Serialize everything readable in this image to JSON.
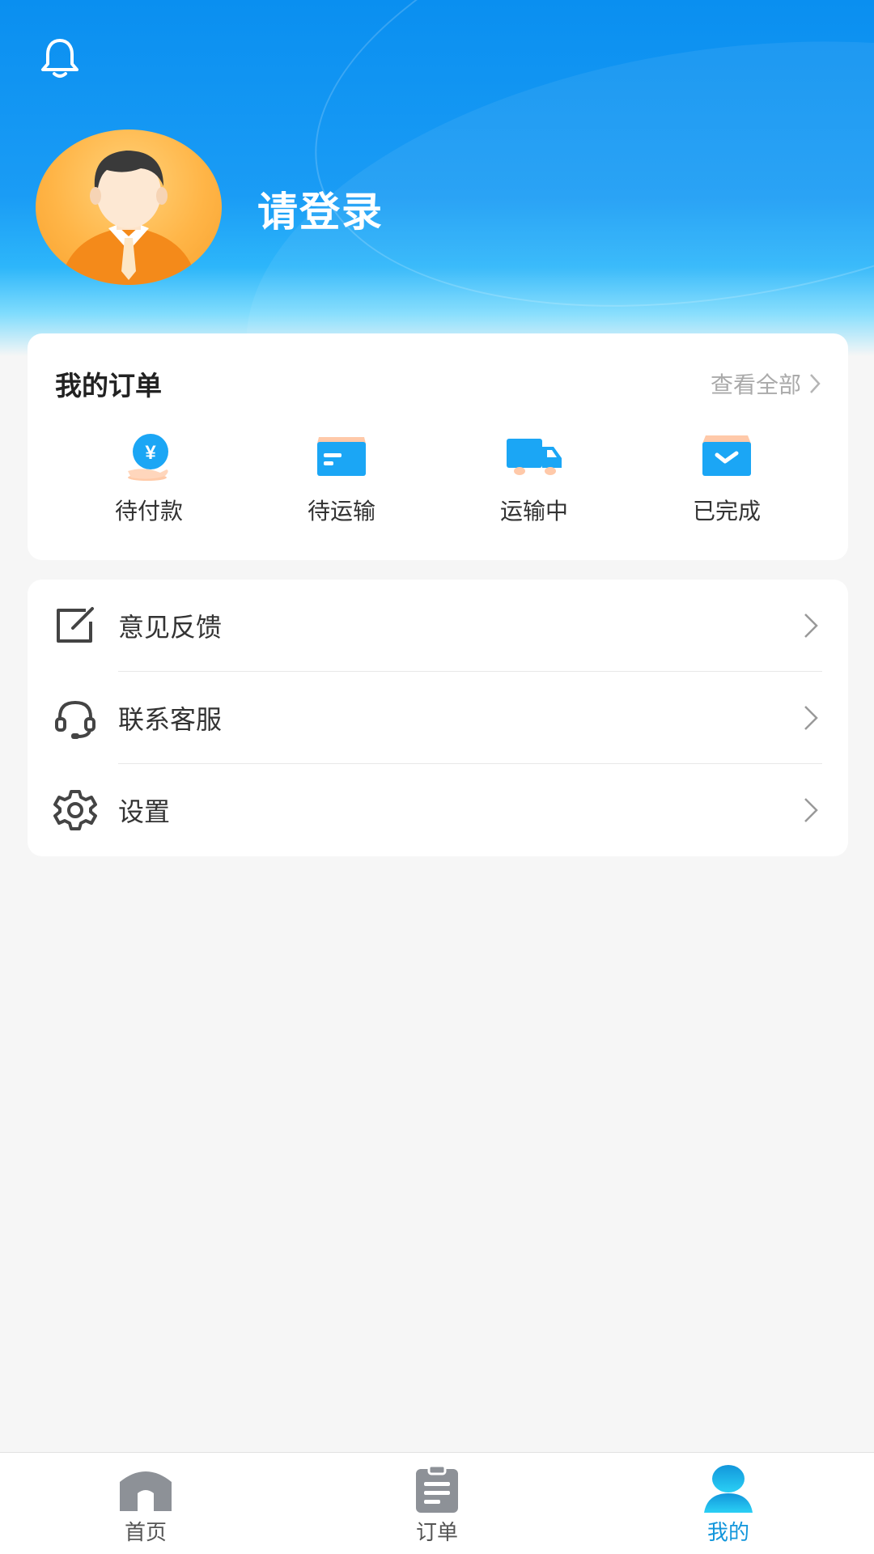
{
  "header": {
    "login_text": "请登录",
    "notification_icon": "bell-icon",
    "avatar_icon": "user-avatar"
  },
  "orders": {
    "title": "我的订单",
    "view_all": "查看全部",
    "items": [
      {
        "label": "待付款",
        "icon": "payment-icon"
      },
      {
        "label": "待运输",
        "icon": "package-icon"
      },
      {
        "label": "运输中",
        "icon": "truck-icon"
      },
      {
        "label": "已完成",
        "icon": "completed-box-icon"
      }
    ]
  },
  "menu": {
    "items": [
      {
        "label": "意见反馈",
        "icon": "edit-icon"
      },
      {
        "label": "联系客服",
        "icon": "headset-icon"
      },
      {
        "label": "设置",
        "icon": "gear-icon"
      }
    ]
  },
  "tabbar": {
    "tabs": [
      {
        "label": "首页",
        "icon": "home-icon",
        "active": false
      },
      {
        "label": "订单",
        "icon": "clipboard-icon",
        "active": false
      },
      {
        "label": "我的",
        "icon": "profile-icon",
        "active": true
      }
    ]
  },
  "colors": {
    "primary": "#1296db",
    "header_top": "#0a8ff0",
    "icon_blue": "#1ba6f5",
    "avatar_orange": "#ffb547",
    "background": "#f6f6f6"
  }
}
